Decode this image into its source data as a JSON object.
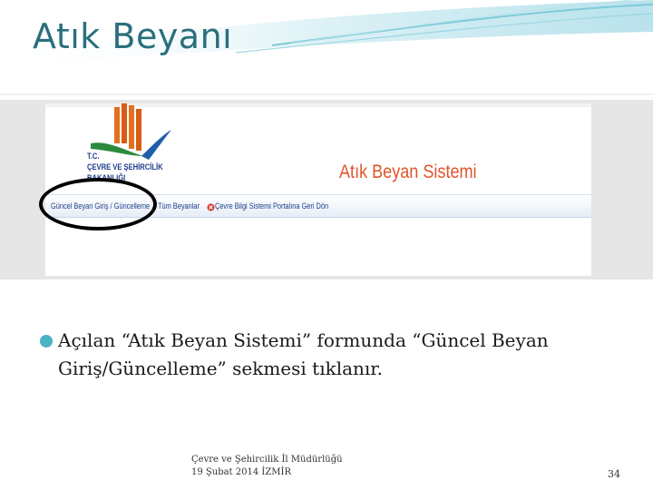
{
  "slide": {
    "title": "Atık Beyanı",
    "bullet": "Açılan “Atık Beyan Sistemi” formunda “Güncel Beyan Giriş/Güncelleme” sekmesi tıklanır.",
    "footer_line1": "Çevre ve Şehircilik İl Müdürlüğü",
    "footer_line2": "19 Şubat 2014 İZMİR",
    "page_number": "34"
  },
  "screenshot": {
    "ministry_lines": [
      "T.C.",
      "ÇEVRE VE ŞEHİRCİLİK",
      "BAKANLIĞI"
    ],
    "system_title": "Atık Beyan Sistemi",
    "nav": {
      "item1": "Güncel Beyan Giriş / Güncelleme",
      "item2": "Tüm Beyanlar",
      "item3": "Çevre Bilgi Sistemi Portalına Geri Dön"
    }
  },
  "colors": {
    "title": "#2a6f7e",
    "accent": "#4bb3c6",
    "system_title": "#e0542b",
    "nav_text": "#1e3f8a"
  }
}
